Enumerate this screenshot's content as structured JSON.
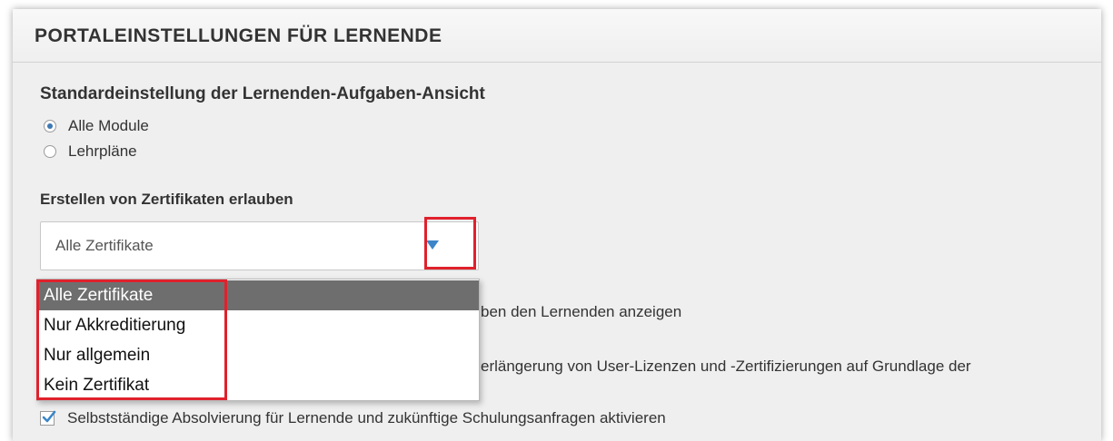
{
  "panel": {
    "title": "PORTALEINSTELLUNGEN FÜR LERNENDE"
  },
  "task_view": {
    "heading": "Standardeinstellung der Lernenden-Aufgaben-Ansicht",
    "options": [
      {
        "label": "Alle Module",
        "checked": true
      },
      {
        "label": "Lehrpläne",
        "checked": false
      }
    ]
  },
  "certificates": {
    "heading": "Erstellen von Zertifikaten erlauben",
    "selected_value": "Alle Zertifikate",
    "options": [
      "Alle Zertifikate",
      "Nur Akkreditierung",
      "Nur allgemein",
      "Kein Zertifikat"
    ],
    "highlighted_index": 0
  },
  "hidden_texts": {
    "line1": "ben den Lernenden anzeigen",
    "line2": "erlängerung von User-Lizenzen und -Zertifizierungen auf Grundlage der"
  },
  "self_completion": {
    "label": "Selbstständige Absolvierung für Lernende und zukünftige Schulungsanfragen aktivieren",
    "checked": true
  },
  "colors": {
    "accent": "#3a86c8",
    "highlight_red": "#e0212c",
    "selected_bg": "#6e6e6e"
  }
}
